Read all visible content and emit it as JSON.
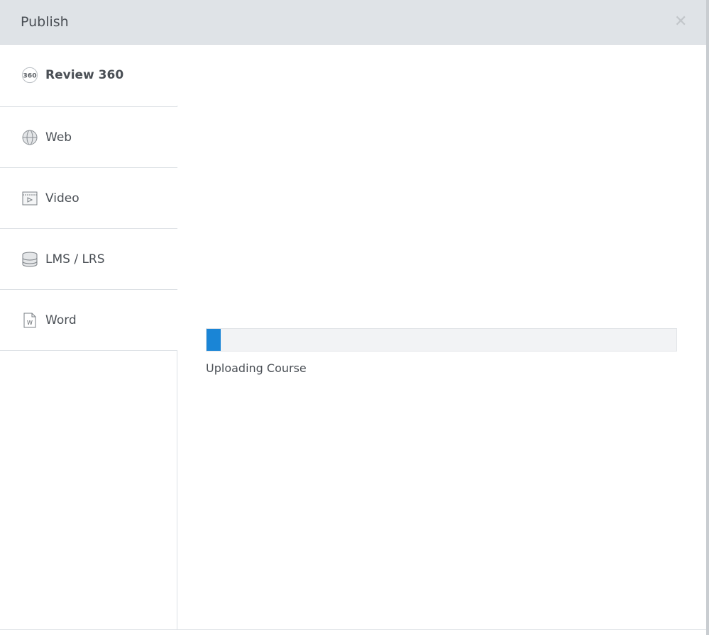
{
  "dialog": {
    "title": "Publish",
    "close_icon": "close-icon"
  },
  "sidebar": {
    "items": [
      {
        "label": "Review 360",
        "icon": "review360-icon",
        "active": true
      },
      {
        "label": "Web",
        "icon": "globe-icon"
      },
      {
        "label": "Video",
        "icon": "video-icon"
      },
      {
        "label": "LMS / LRS",
        "icon": "database-icon"
      },
      {
        "label": "Word",
        "icon": "word-document-icon"
      }
    ]
  },
  "progress": {
    "percent": 3,
    "label": "Uploading Course",
    "color": "#1a85d6"
  }
}
